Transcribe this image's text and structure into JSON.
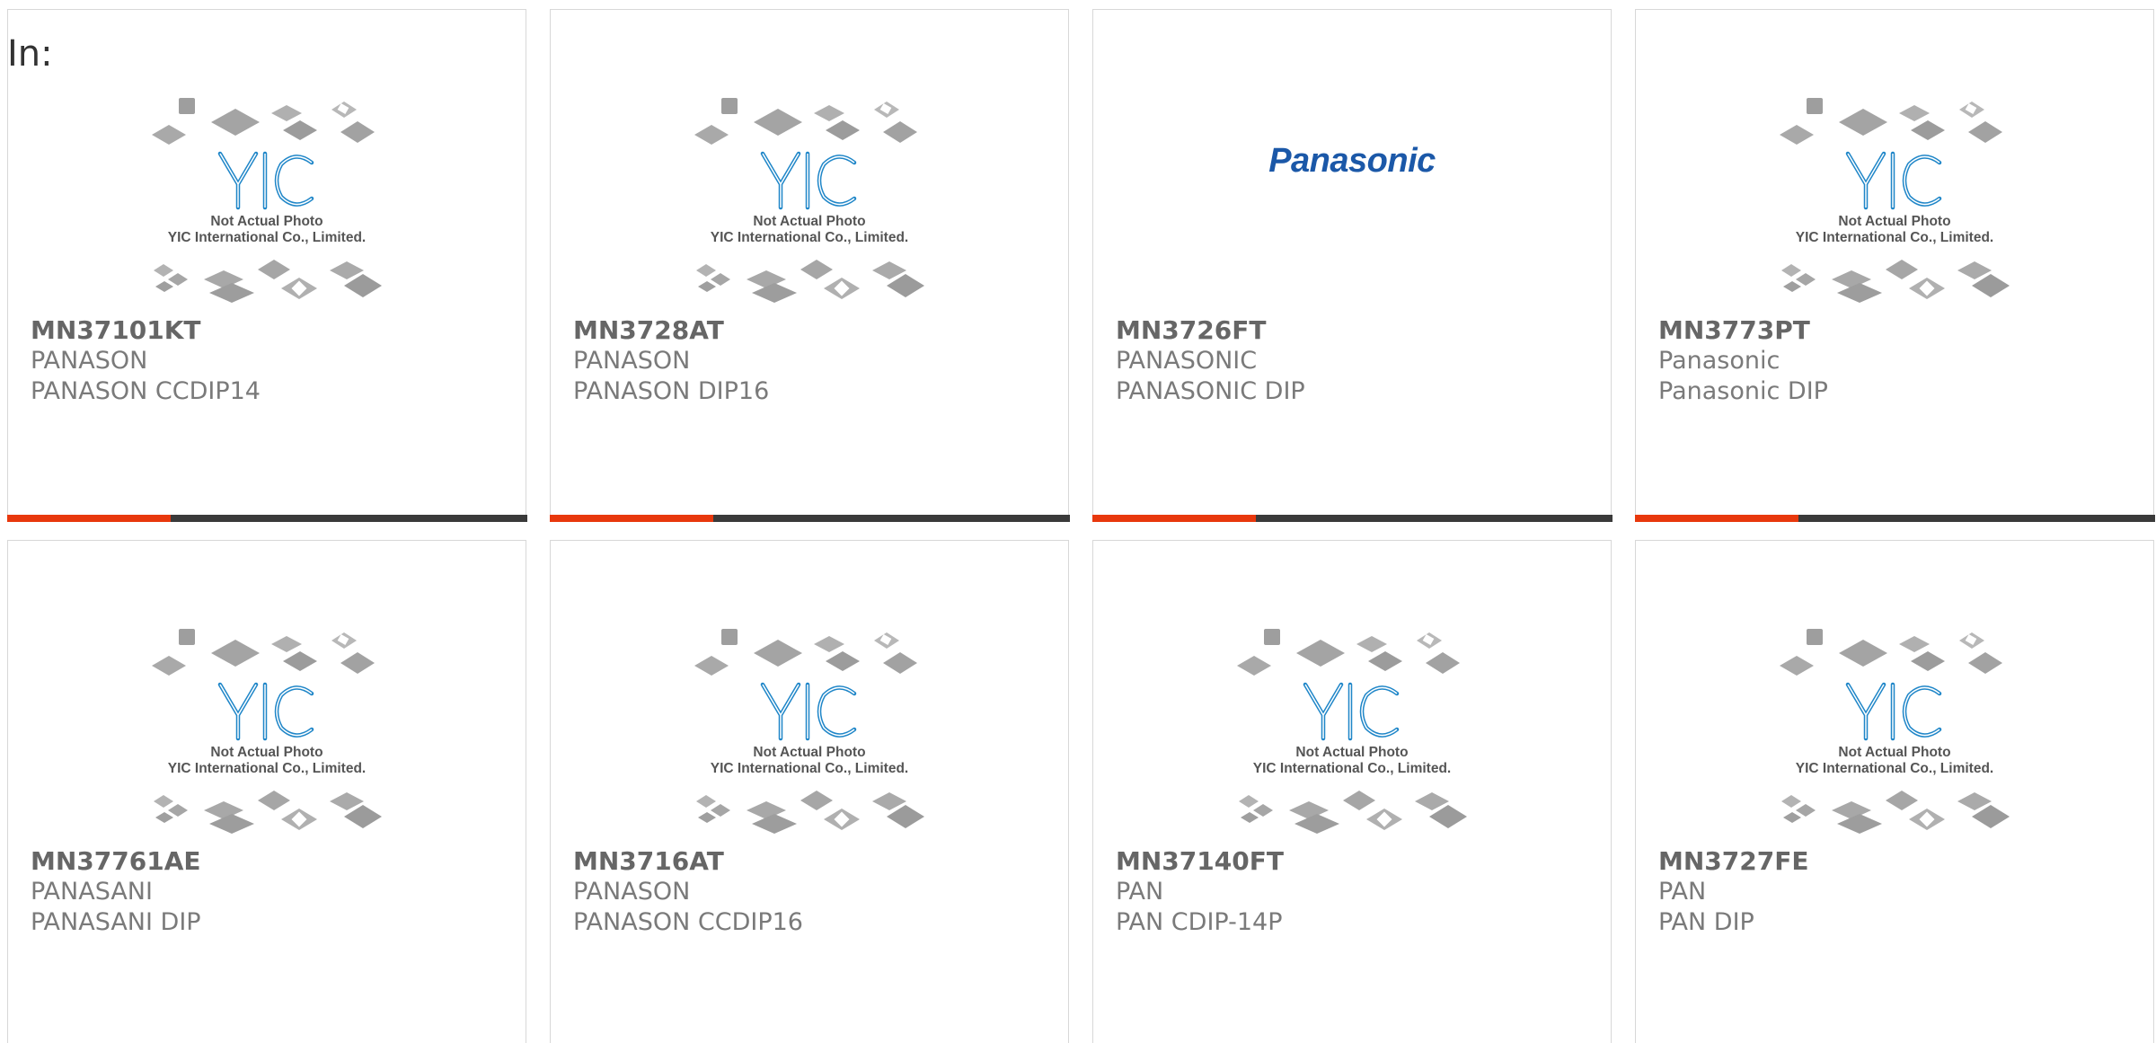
{
  "filter_label": "In:",
  "colors": {
    "accent": "#e8380d",
    "bar": "#3a3a3a",
    "yic_blue": "#1f86c8",
    "panasonic_blue": "#1b58a8"
  },
  "placeholder": {
    "line1": "Not Actual Photo",
    "line2": "YIC International Co., Limited."
  },
  "products": [
    {
      "part": "MN37101KT",
      "maker": "PANASON",
      "package": "PANASON CCDIP14",
      "image": "yic-placeholder"
    },
    {
      "part": "MN3728AT",
      "maker": "PANASON",
      "package": "PANASON DIP16",
      "image": "yic-placeholder"
    },
    {
      "part": "MN3726FT",
      "maker": "PANASONIC",
      "package": "PANASONIC DIP",
      "image": "panasonic-logo",
      "logo_text": "Panasonic"
    },
    {
      "part": "MN3773PT",
      "maker": "Panasonic",
      "package": "Panasonic DIP",
      "image": "yic-placeholder"
    },
    {
      "part": "MN37761AE",
      "maker": "PANASANI",
      "package": "PANASANI DIP",
      "image": "yic-placeholder"
    },
    {
      "part": "MN3716AT",
      "maker": "PANASON",
      "package": "PANASON CCDIP16",
      "image": "yic-placeholder"
    },
    {
      "part": "MN37140FT",
      "maker": "PAN",
      "package": "PAN CDIP-14P",
      "image": "yic-placeholder"
    },
    {
      "part": "MN3727FE",
      "maker": "PAN",
      "package": "PAN DIP",
      "image": "yic-placeholder"
    }
  ]
}
